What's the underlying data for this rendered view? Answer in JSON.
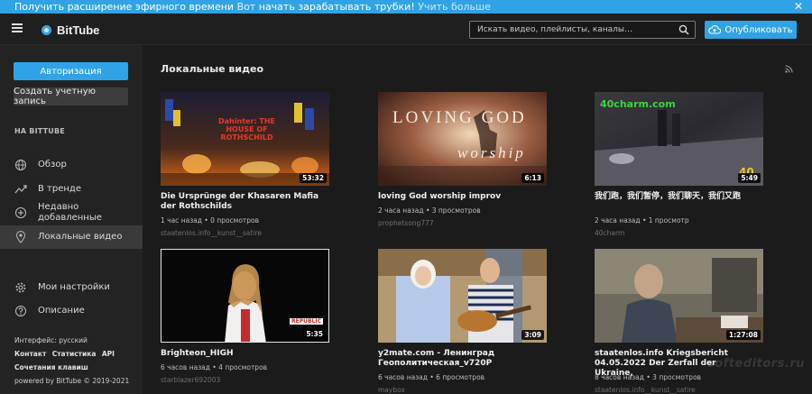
{
  "banner": {
    "part1": "Получить расширение эфирного времени",
    "part2": "Вот",
    "part3": "начать зарабатывать трубки!",
    "part4": "Учить больше",
    "close": "✕"
  },
  "header": {
    "logo": "BitTube",
    "search_placeholder": "Искать видео, плейлисты, каналы…",
    "publish": "Опубликовать"
  },
  "sidebar": {
    "auth": "Авторизация",
    "create": "Создать учетную запись",
    "section": "НА BITTUBE",
    "items": [
      {
        "label": "Обзор",
        "icon": "globe-icon"
      },
      {
        "label": "В тренде",
        "icon": "trending-icon"
      },
      {
        "label": "Недавно добавленные",
        "icon": "plus-circle-icon"
      },
      {
        "label": "Локальные видео",
        "icon": "location-pin-icon"
      },
      {
        "label": "Мои настройки",
        "icon": "gear-icon"
      },
      {
        "label": "Описание",
        "icon": "help-icon"
      }
    ],
    "interface": "Интерфейс: русский",
    "links": [
      "Контакт",
      "Статистика",
      "API"
    ],
    "shortcuts": "Сочетания клавиш",
    "powered": "powered by BitTube © 2019-2021"
  },
  "main": {
    "title": "Локальные видео",
    "videos": [
      {
        "title": "Die Ursprünge der Khasaren Mafia der Rothschilds",
        "meta": "1 час назад • 0 просмотров",
        "author": "staatenlos.info__kunst__satire",
        "duration": "53:32",
        "overlay": "Dahinter: THE HOUSE OF ROTHSCHILD"
      },
      {
        "title": "loving God worship improv",
        "meta": "2 часа назад • 3 просмотров",
        "author": "prophetsong777",
        "duration": "6:13",
        "overlay1": "LOVING GOD",
        "overlay2": "worship"
      },
      {
        "title": "我们跑，我们暂停，我们聊天，我们又跑",
        "meta": "2 часа назад • 1 просмотр",
        "author": "40charm",
        "duration": "5:49",
        "overlay": "40charm.com",
        "overlay2": "40"
      },
      {
        "title": "Brighteon_HIGH",
        "meta": "6 часов назад • 4 просмотров",
        "author": "starblazer692003",
        "duration": "5:35",
        "overlay": "REPUBLIC"
      },
      {
        "title": "y2mate.com - Ленинград Геополитическая_v720P",
        "meta": "6 часов назад • 6 просмотров",
        "author": "maybox",
        "duration": "3:09"
      },
      {
        "title": "staatenlos.info Kriegsbericht 04.05.2022 Der Zerfall der Ukraine,",
        "meta": "8 часов назад • 3 просмотров",
        "author": "staatenlos.info__kunst__satire",
        "duration": "1:27:08"
      }
    ]
  },
  "watermark": "softeditors.ru"
}
